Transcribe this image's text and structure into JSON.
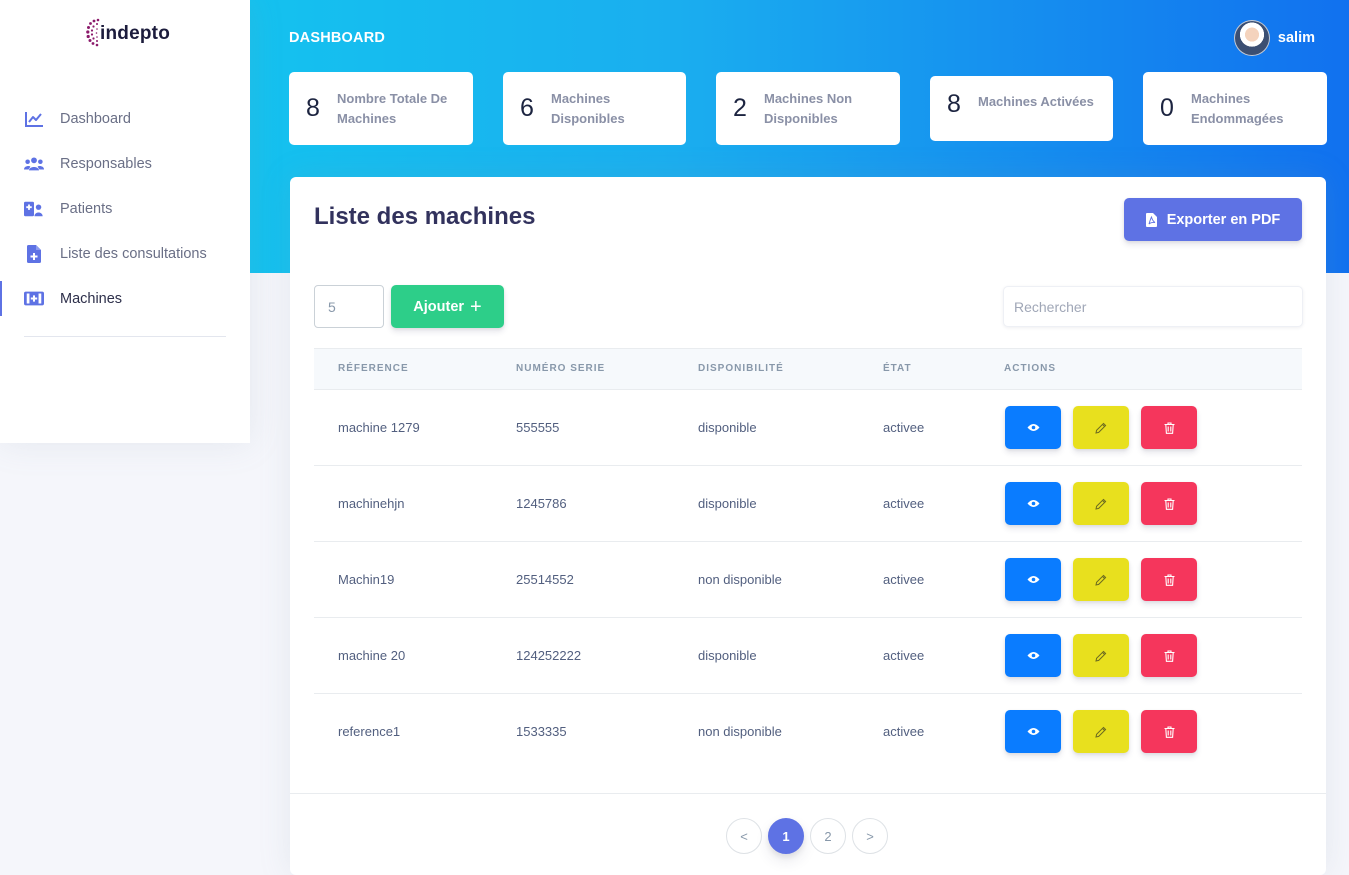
{
  "brand": {
    "name": "indepto"
  },
  "header": {
    "title": "DASHBOARD",
    "user_name": "salim"
  },
  "sidebar": {
    "items": [
      {
        "label": "Dashboard",
        "icon": "chart-line-icon"
      },
      {
        "label": "Responsables",
        "icon": "users-icon"
      },
      {
        "label": "Patients",
        "icon": "patient-icon"
      },
      {
        "label": "Liste des consultations",
        "icon": "file-medical-icon"
      },
      {
        "label": "Machines",
        "icon": "medical-device-icon",
        "active": true
      }
    ]
  },
  "stats": [
    {
      "value": "8",
      "label_line1": "Nombre Totale De",
      "label_line2": "Machines"
    },
    {
      "value": "6",
      "label_line1": "Machines",
      "label_line2": "Disponibles"
    },
    {
      "value": "2",
      "label_line1": "Machines Non",
      "label_line2": "Disponibles"
    },
    {
      "value": "8",
      "label_line1": "Machines Activées",
      "label_line2": ""
    },
    {
      "value": "0",
      "label_line1": "Machines",
      "label_line2": "Endommagées"
    }
  ],
  "card": {
    "title": "Liste des machines",
    "export_label": "Exporter en PDF",
    "page_size": "5",
    "add_label": "Ajouter",
    "search_placeholder": "Rechercher"
  },
  "table": {
    "headers": [
      "Réference",
      "Numéro serie",
      "Disponibilité",
      "État",
      "Actions"
    ],
    "rows": [
      {
        "reference": "machine 1279",
        "serie": "555555",
        "disponibilite": "disponible",
        "etat": "activee"
      },
      {
        "reference": "machinehjn",
        "serie": "1245786",
        "disponibilite": "disponible",
        "etat": "activee"
      },
      {
        "reference": "Machin19",
        "serie": "25514552",
        "disponibilite": "non disponible",
        "etat": "activee"
      },
      {
        "reference": "machine 20",
        "serie": "124252222",
        "disponibilite": "disponible",
        "etat": "activee"
      },
      {
        "reference": "reference1",
        "serie": "1533335",
        "disponibilite": "non disponible",
        "etat": "activee"
      }
    ]
  },
  "pagination": {
    "prev": "<",
    "pages": [
      "1",
      "2"
    ],
    "current": "1",
    "next": ">"
  },
  "colors": {
    "primary": "#5e72e4",
    "success": "#2dce89",
    "view_button": "#0a7cff",
    "edit_button": "#e8e01e",
    "delete_button": "#f5365c",
    "header_gradient_start": "#11cdef",
    "header_gradient_end": "#1171ef"
  }
}
